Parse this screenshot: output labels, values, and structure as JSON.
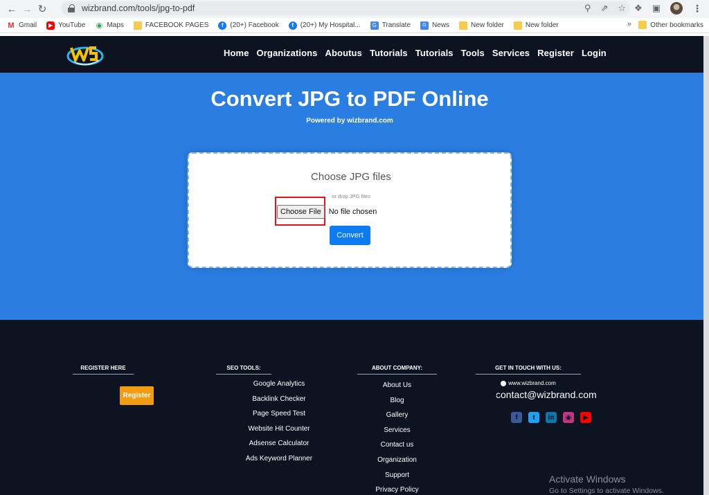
{
  "browser": {
    "url": "wizbrand.com/tools/jpg-to-pdf"
  },
  "bookmarks": [
    {
      "label": "Gmail",
      "icon": "gmail-icon"
    },
    {
      "label": "YouTube",
      "icon": "youtube-icon"
    },
    {
      "label": "Maps",
      "icon": "maps-icon"
    },
    {
      "label": "FACEBOOK PAGES",
      "icon": "folder-icon"
    },
    {
      "label": "(20+) Facebook",
      "icon": "facebook-icon"
    },
    {
      "label": "(20+) My Hospital...",
      "icon": "facebook-icon"
    },
    {
      "label": "Translate",
      "icon": "translate-icon"
    },
    {
      "label": "News",
      "icon": "news-icon"
    },
    {
      "label": "New folder",
      "icon": "folder-icon"
    },
    {
      "label": "New folder",
      "icon": "folder-icon"
    }
  ],
  "other_bookmarks": "Other bookmarks",
  "site": {
    "nav": [
      "Home",
      "Organizations",
      "Aboutus",
      "Tutorials",
      "Tutorials",
      "Tools",
      "Services",
      "Register",
      "Login"
    ],
    "hero_title": "Convert JPG to PDF Online",
    "hero_sub": "Powered by wizbrand.com",
    "card_heading": "Choose JPG files",
    "card_or": "or drop JPG files",
    "choose_file": "Choose File",
    "no_file": "No file chosen",
    "convert": "Convert"
  },
  "footer": {
    "register_head": "REGISTER HERE",
    "register_btn": "Register",
    "seo_head": "SEO TOOLS:",
    "seo_tools": [
      "Google Analytics",
      "Backlink Checker",
      "Page Speed Test",
      "Website Hit Counter",
      "Adsense Calculator",
      "Ads Keyword Planner"
    ],
    "about_head": "ABOUT COMPANY:",
    "about_links": [
      "About Us",
      "Blog",
      "Gallery",
      "Services",
      "Contact us",
      "Organization",
      "Support",
      "Privacy Policy"
    ],
    "contact_head": "GET IN TOUCH WITH US:",
    "website": "www.wizbrand.com",
    "email": "contact@wizbrand.com"
  },
  "watermark": {
    "line1": "Activate Windows",
    "line2": "Go to Settings to activate Windows."
  },
  "colors": {
    "navy": "#0d1321",
    "hero_blue": "#2a7de1",
    "convert_blue": "#0d7bf2",
    "register_orange": "#f39c12",
    "highlight_red": "#e0141e"
  }
}
